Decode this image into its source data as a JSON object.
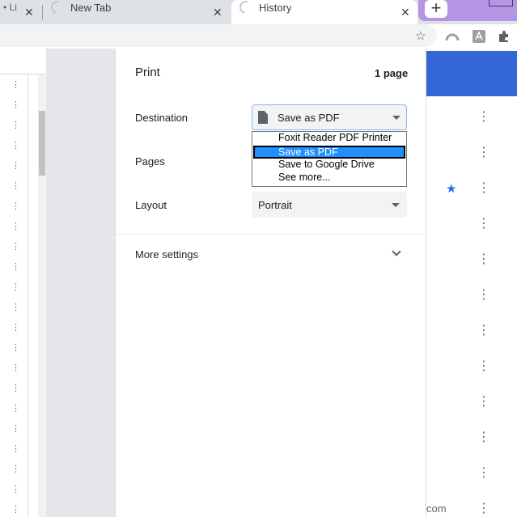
{
  "tabs": {
    "left_tab_title": "• Li",
    "left_tab_close": "✕",
    "new_tab_title": "New Tab",
    "new_tab_close": "✕",
    "history_tab_title": "History",
    "history_tab_close": "✕",
    "new_tab_button": "+"
  },
  "toolbar": {
    "icons": [
      "star-icon",
      "profile-icon",
      "acrobat-icon",
      "extensions-icon"
    ]
  },
  "print": {
    "title": "Print",
    "page_count": "1 page",
    "destination_label": "Destination",
    "destination_value": "Save as PDF",
    "pages_label": "Pages",
    "layout_label": "Layout",
    "layout_value": "Portrait",
    "more_settings": "More settings"
  },
  "destination_dropdown": {
    "options": [
      "Foxit Reader PDF Printer",
      "Save as PDF",
      "Save to Google Drive",
      "See more..."
    ],
    "selected": "Save as PDF"
  },
  "history_backdrop": {
    "domain_fragment": "com"
  },
  "colors": {
    "history_header": "#3367d6",
    "dropdown_selected": "#1e90ff",
    "accent_star": "#1a73e8",
    "tab_strip": "#dee1e6",
    "profile_area": "#b694e6"
  }
}
